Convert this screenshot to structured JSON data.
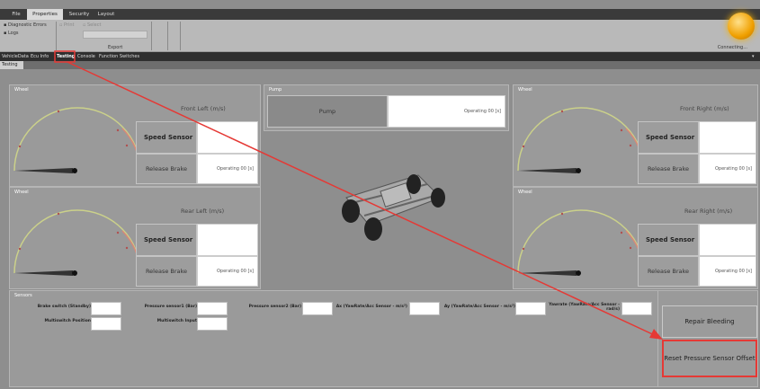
{
  "ribbon": {
    "tabs": [
      {
        "label": "File"
      },
      {
        "label": "Properties"
      },
      {
        "label": "Security"
      },
      {
        "label": "Layout"
      }
    ],
    "items": {
      "diag": "Diagnostic Errors",
      "print": "Print",
      "select": "Select",
      "logs": "Logs",
      "export": "Export"
    },
    "status": "Connecting..."
  },
  "nav": {
    "items": [
      {
        "label": "VehicleData"
      },
      {
        "label": "Ecu Info"
      },
      {
        "label": "Testing"
      },
      {
        "label": "Console"
      },
      {
        "label": "Function Switches"
      }
    ]
  },
  "subtab": {
    "label": "Testing"
  },
  "wheel_fl": {
    "title": "Wheel",
    "heading": "Front Left (m/s)",
    "sensor": "Speed Sensor",
    "brake": "Release Brake",
    "status": "Operating 00 [s]"
  },
  "wheel_fr": {
    "title": "Wheel",
    "heading": "Front Right (m/s)",
    "sensor": "Speed Sensor",
    "brake": "Release Brake",
    "status": "Operating 00 [s]"
  },
  "wheel_rl": {
    "title": "Wheel",
    "heading": "Rear Left (m/s)",
    "sensor": "Speed Sensor",
    "brake": "Release Brake",
    "status": "Operating 00 [s]"
  },
  "wheel_rr": {
    "title": "Wheel",
    "heading": "Rear Right (m/s)",
    "sensor": "Speed Sensor",
    "brake": "Release Brake",
    "status": "Operating 00 [s]"
  },
  "pump": {
    "title": "Pump",
    "button": "Pump",
    "status": "Operating 00 [s]"
  },
  "sensors": {
    "title": "Sensors",
    "brake_switch": "Brake switch (Standby)",
    "multiswitch_pos": "Multiswitch Position",
    "pressure1": "Pressure sensor1 (Bar)",
    "multiswitch_in": "Multiswitch Input",
    "pressure2": "Pressure sensor2 (Bar)",
    "ax": "Ax (YawRate/Acc Sensor - m/s²)",
    "ay": "Ay (YawRate/Acc Sensor - m/s²)",
    "yaw": "Yawrate (YawRate/Acc Sensor - rad/s)"
  },
  "actions": {
    "repair": "Repair Bleeding",
    "reset": "Reset Pressure Sensor Offset"
  },
  "colors": {
    "annotation": "#e53935",
    "orb": "#f5b000"
  }
}
